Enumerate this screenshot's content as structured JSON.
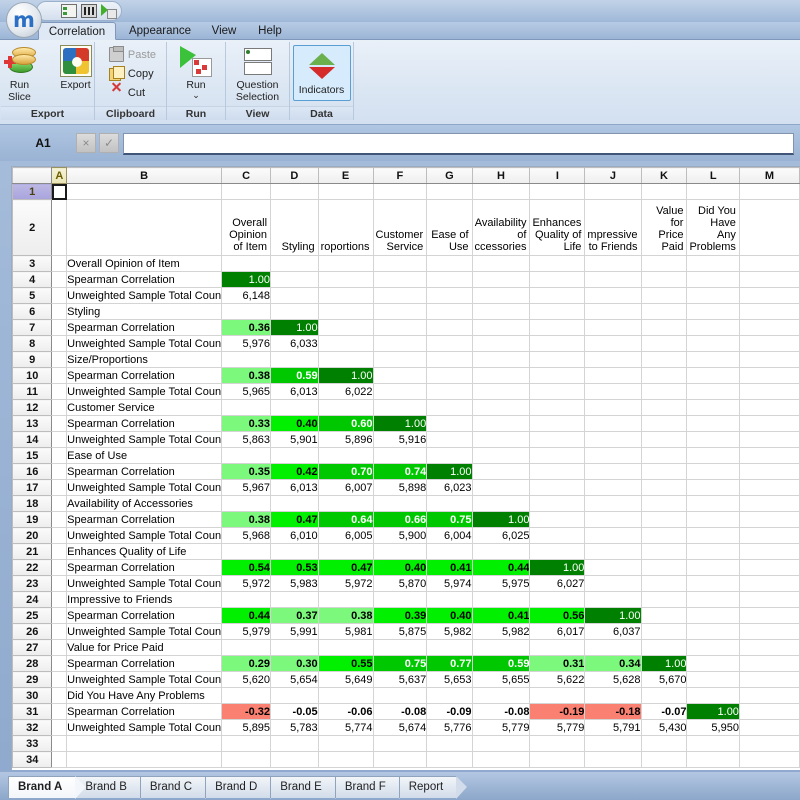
{
  "window": {
    "logo": "m",
    "quick_access": [
      "list-icon",
      "grid-icon",
      "lightning-icon"
    ]
  },
  "ribbon": {
    "tabs": [
      {
        "label": "Correlation",
        "active": true
      },
      {
        "label": "Appearance",
        "active": false
      },
      {
        "label": "View",
        "active": false
      },
      {
        "label": "Help",
        "active": false
      }
    ],
    "groups": [
      {
        "name": "Export",
        "label": "Export",
        "buttons": [
          {
            "label": "Run\nSlice",
            "icon": "database-run-icon",
            "type": "big"
          },
          {
            "label": "Export",
            "icon": "export-colorwheel-icon",
            "type": "big"
          }
        ]
      },
      {
        "name": "Clipboard",
        "label": "Clipboard",
        "buttons": [
          {
            "label": "Paste",
            "icon": "paste-icon",
            "type": "small",
            "disabled": true
          },
          {
            "label": "Copy",
            "icon": "copy-icon",
            "type": "small",
            "disabled": false
          },
          {
            "label": "Cut",
            "icon": "cut-icon",
            "type": "small",
            "disabled": false
          }
        ]
      },
      {
        "name": "Run",
        "label": "Run",
        "buttons": [
          {
            "label": "Run",
            "sublabel": "⌄",
            "icon": "run-lightning-icon",
            "type": "big"
          }
        ]
      },
      {
        "name": "View",
        "label": "View",
        "buttons": [
          {
            "label": "Question\nSelection",
            "icon": "question-selection-icon",
            "type": "big"
          }
        ]
      },
      {
        "name": "Data",
        "label": "Data",
        "buttons": [
          {
            "label": "Indicators",
            "icon": "indicators-triangles-icon",
            "type": "big",
            "selected": true
          }
        ]
      }
    ]
  },
  "formula_bar": {
    "name_box": "A1",
    "cancel_icon": "×",
    "accept_icon": "✓",
    "value": "",
    "placeholder": ""
  },
  "spreadsheet": {
    "selected_cell": "A1",
    "column_headers": [
      "A",
      "B",
      "C",
      "D",
      "E",
      "F",
      "G",
      "H",
      "I",
      "J",
      "K",
      "L",
      "M"
    ],
    "header_row_number": "2",
    "header_labels": [
      "",
      "",
      "Overall Opinion of Item",
      "Styling",
      "roportions",
      "Customer Service",
      "Ease of Use",
      "Availability of ccessories",
      "Enhances Quality of Life",
      "mpressive to Friends",
      "Value for Price Paid",
      "Did You Have Any Problems",
      ""
    ],
    "blank_row_numbers": [
      "1",
      "33",
      "34"
    ],
    "stat_labels": {
      "correlation": "Spearman Correlation",
      "count": "Unweighted Sample Total Coun"
    },
    "blocks": [
      {
        "group_row": "3",
        "group": "Overall Opinion of Item",
        "corr_row": "4",
        "count_row": "5",
        "correlations": [
          "1.00"
        ],
        "counts": [
          "6,148"
        ]
      },
      {
        "group_row": "6",
        "group": "Styling",
        "corr_row": "7",
        "count_row": "8",
        "correlations": [
          "0.36",
          "1.00"
        ],
        "counts": [
          "5,976",
          "6,033"
        ]
      },
      {
        "group_row": "9",
        "group": "Size/Proportions",
        "corr_row": "10",
        "count_row": "11",
        "correlations": [
          "0.38",
          "0.59",
          "1.00"
        ],
        "counts": [
          "5,965",
          "6,013",
          "6,022"
        ]
      },
      {
        "group_row": "12",
        "group": "Customer Service",
        "corr_row": "13",
        "count_row": "14",
        "correlations": [
          "0.33",
          "0.40",
          "0.60",
          "1.00"
        ],
        "counts": [
          "5,863",
          "5,901",
          "5,896",
          "5,916"
        ]
      },
      {
        "group_row": "15",
        "group": "Ease of Use",
        "corr_row": "16",
        "count_row": "17",
        "correlations": [
          "0.35",
          "0.42",
          "0.70",
          "0.74",
          "1.00"
        ],
        "counts": [
          "5,967",
          "6,013",
          "6,007",
          "5,898",
          "6,023"
        ]
      },
      {
        "group_row": "18",
        "group": "Availability of Accessories",
        "corr_row": "19",
        "count_row": "20",
        "correlations": [
          "0.38",
          "0.47",
          "0.64",
          "0.66",
          "0.75",
          "1.00"
        ],
        "counts": [
          "5,968",
          "6,010",
          "6,005",
          "5,900",
          "6,004",
          "6,025"
        ]
      },
      {
        "group_row": "21",
        "group": "Enhances Quality of Life",
        "corr_row": "22",
        "count_row": "23",
        "correlations": [
          "0.54",
          "0.53",
          "0.47",
          "0.40",
          "0.41",
          "0.44",
          "1.00"
        ],
        "counts": [
          "5,972",
          "5,983",
          "5,972",
          "5,870",
          "5,974",
          "5,975",
          "6,027"
        ]
      },
      {
        "group_row": "24",
        "group": "Impressive to Friends",
        "corr_row": "25",
        "count_row": "26",
        "correlations": [
          "0.44",
          "0.37",
          "0.38",
          "0.39",
          "0.40",
          "0.41",
          "0.56",
          "1.00"
        ],
        "counts": [
          "5,979",
          "5,991",
          "5,981",
          "5,875",
          "5,982",
          "5,982",
          "6,017",
          "6,037"
        ]
      },
      {
        "group_row": "27",
        "group": "Value for Price Paid",
        "corr_row": "28",
        "count_row": "29",
        "correlations": [
          "0.29",
          "0.30",
          "0.55",
          "0.75",
          "0.77",
          "0.59",
          "0.31",
          "0.34",
          "1.00"
        ],
        "counts": [
          "5,620",
          "5,654",
          "5,649",
          "5,637",
          "5,653",
          "5,655",
          "5,622",
          "5,628",
          "5,670"
        ]
      },
      {
        "group_row": "30",
        "group": "Did You Have Any Problems",
        "corr_row": "31",
        "count_row": "32",
        "correlations": [
          "-0.32",
          "-0.05",
          "-0.06",
          "-0.08",
          "-0.09",
          "-0.08",
          "-0.19",
          "-0.18",
          "-0.07",
          "1.00"
        ],
        "counts": [
          "5,895",
          "5,783",
          "5,774",
          "5,674",
          "5,776",
          "5,779",
          "5,779",
          "5,791",
          "5,430",
          "5,950"
        ]
      }
    ]
  },
  "sheet_tabs": [
    {
      "label": "Brand A",
      "active": true
    },
    {
      "label": "Brand B",
      "active": false
    },
    {
      "label": "Brand C",
      "active": false
    },
    {
      "label": "Brand D",
      "active": false
    },
    {
      "label": "Brand E",
      "active": false
    },
    {
      "label": "Brand F",
      "active": false
    },
    {
      "label": "Report",
      "active": false
    }
  ],
  "colors": {
    "heat_max_green": "#008000",
    "heat_mid_green": "#00cc00",
    "heat_low_green": "#7cf97c",
    "heat_negative_red": "#fa8072",
    "accent": "#2a6fc4"
  }
}
